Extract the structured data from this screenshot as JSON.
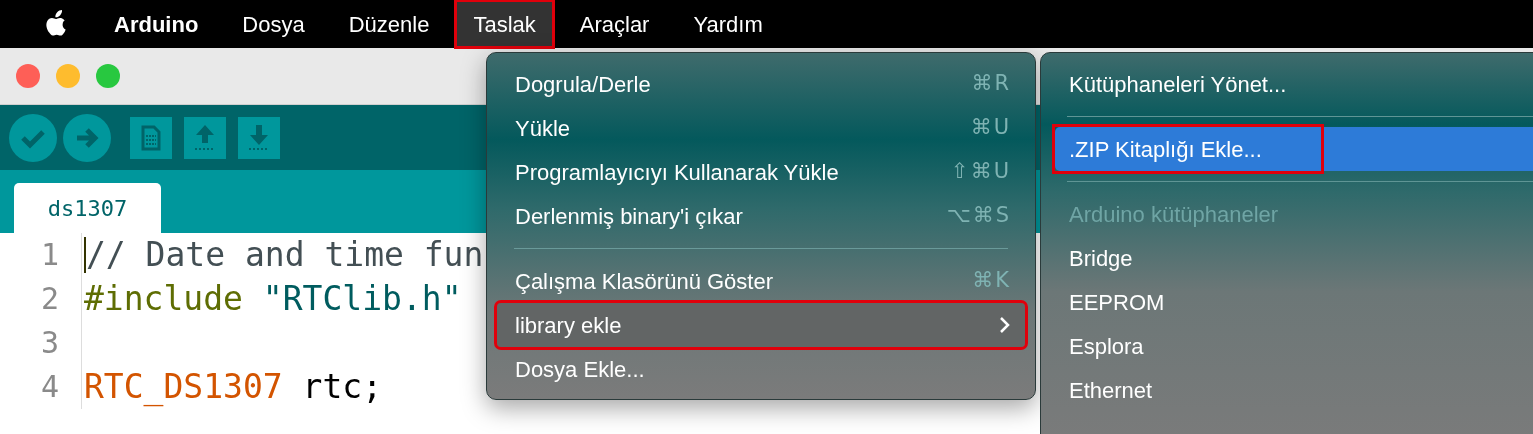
{
  "menu_bar": {
    "items": [
      {
        "label": "Arduino",
        "kind": "app",
        "selected": false,
        "annotated": false
      },
      {
        "label": "Dosya",
        "kind": "menu",
        "selected": false,
        "annotated": false
      },
      {
        "label": "Düzenle",
        "kind": "menu",
        "selected": false,
        "annotated": false
      },
      {
        "label": "Taslak",
        "kind": "menu",
        "selected": true,
        "annotated": true
      },
      {
        "label": "Araçlar",
        "kind": "menu",
        "selected": false,
        "annotated": false
      },
      {
        "label": "Yardım",
        "kind": "menu",
        "selected": false,
        "annotated": false
      }
    ]
  },
  "window": {
    "tabs": [
      {
        "label": "ds1307",
        "selected": true
      }
    ],
    "editor": {
      "lines": [
        {
          "number": "1",
          "cursor": true,
          "tokens": [
            {
              "text": "// Date and time fun",
              "kind": "comment"
            }
          ]
        },
        {
          "number": "2",
          "tokens": [
            {
              "text": "#include",
              "kind": "directive"
            },
            {
              "text": " \"RTClib.h\"",
              "kind": "string"
            }
          ]
        },
        {
          "number": "3"
        },
        {
          "number": "4",
          "tokens": [
            {
              "text": "RTC_DS1307",
              "kind": "type"
            },
            {
              "text": " rtc;",
              "kind": "plain"
            }
          ]
        }
      ]
    }
  },
  "menu": {
    "items": [
      {
        "kind": "item",
        "label": "Dogrula/Derle",
        "shortcut": "⌘R",
        "submenu": false,
        "selected": false,
        "annotated": false
      },
      {
        "kind": "item",
        "label": "Yükle",
        "shortcut": "⌘U",
        "submenu": false,
        "selected": false,
        "annotated": false
      },
      {
        "kind": "item",
        "label": "Programlayıcıyı Kullanarak Yükle",
        "shortcut": "⇧⌘U",
        "submenu": false,
        "selected": false,
        "annotated": false
      },
      {
        "kind": "item",
        "label": "Derlenmiş binary'i çıkar",
        "shortcut": "⌥⌘S",
        "submenu": false,
        "selected": false,
        "annotated": false
      },
      {
        "kind": "separator"
      },
      {
        "kind": "item",
        "label": "Çalışma Klasörünü Göster",
        "shortcut": "⌘K",
        "submenu": false,
        "selected": false,
        "annotated": false
      },
      {
        "kind": "item",
        "label": "library ekle",
        "submenu": true,
        "selected": true,
        "annotated": true
      },
      {
        "kind": "item",
        "label": "Dosya Ekle...",
        "submenu": false,
        "selected": false,
        "annotated": false
      }
    ]
  },
  "submenu": {
    "items": [
      {
        "kind": "item",
        "label": "Kütüphaneleri Yönet...",
        "selected": false,
        "annotated": false
      },
      {
        "kind": "separator"
      },
      {
        "kind": "item",
        "label": ".ZIP Kitaplığı Ekle...",
        "selected": true,
        "annotated": true
      },
      {
        "kind": "separator"
      },
      {
        "kind": "header",
        "label": "Arduino kütüphaneler"
      },
      {
        "kind": "item",
        "label": "Bridge",
        "selected": false,
        "annotated": false
      },
      {
        "kind": "item",
        "label": "EEPROM",
        "selected": false,
        "annotated": false
      },
      {
        "kind": "item",
        "label": "Esplora",
        "selected": false,
        "annotated": false
      },
      {
        "kind": "item",
        "label": "Ethernet",
        "selected": false,
        "annotated": false
      }
    ]
  }
}
